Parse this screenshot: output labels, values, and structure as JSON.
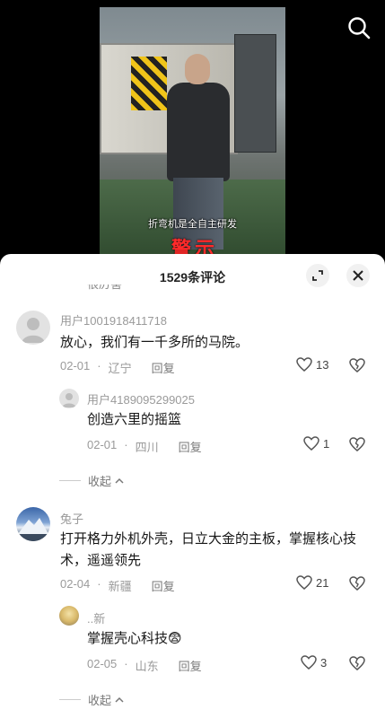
{
  "video": {
    "subtitle": "折弯机是全自主研发",
    "warning_label": "警示"
  },
  "panel": {
    "title": "1529条评论",
    "cut_text": "很厉害"
  },
  "comments": [
    {
      "username": "用户1001918411718",
      "text": "放心，我们有一千多所的马院。",
      "date": "02-01",
      "location": "辽宁",
      "reply_label": "回复",
      "likes": "13",
      "replies": [
        {
          "username": "用户4189095299025",
          "text": "创造六里的摇篮",
          "date": "02-01",
          "location": "四川",
          "reply_label": "回复",
          "likes": "1"
        }
      ],
      "collapse_label": "收起"
    },
    {
      "username": "兔子",
      "text": "打开格力外机外壳，日立大金的主板，掌握核心技术，遥遥领先",
      "date": "02-04",
      "location": "新疆",
      "reply_label": "回复",
      "likes": "21",
      "replies": [
        {
          "username": "..新",
          "text": "掌握壳心科技",
          "emoji": "😨",
          "date": "02-05",
          "location": "山东",
          "reply_label": "回复",
          "likes": "3"
        }
      ],
      "collapse_label": "收起"
    }
  ],
  "icons": {
    "search": "search-icon",
    "expand": "expand-icon",
    "close": "close-icon",
    "like": "heart-icon",
    "dislike": "broken-heart-icon",
    "collapse": "chevron-up-icon"
  }
}
